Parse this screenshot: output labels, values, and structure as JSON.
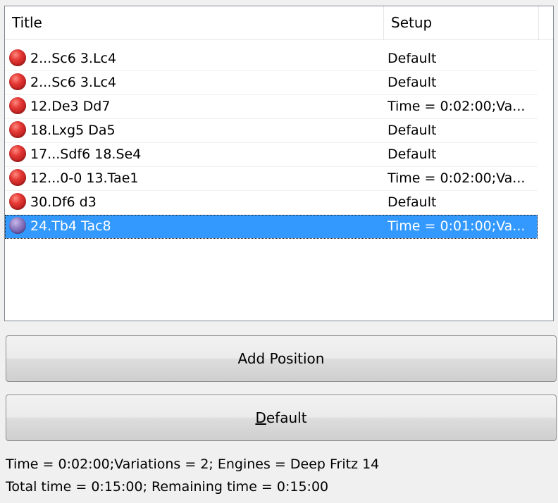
{
  "table": {
    "columns": [
      "Title",
      "Setup"
    ],
    "rows": [
      {
        "title": "2...Sc6 3.Lc4",
        "setup": "Default",
        "icon": "red-ball-icon"
      },
      {
        "title": "2...Sc6 3.Lc4",
        "setup": "Default",
        "icon": "red-ball-icon"
      },
      {
        "title": "12.De3 Dd7",
        "setup": "Time = 0:02:00;Va...",
        "icon": "red-ball-icon"
      },
      {
        "title": "18.Lxg5 Da5",
        "setup": "Default",
        "icon": "red-ball-icon"
      },
      {
        "title": "17...Sdf6 18.Se4",
        "setup": "Default",
        "icon": "red-ball-icon"
      },
      {
        "title": "12...0-0 13.Tae1",
        "setup": "Time = 0:02:00;Va...",
        "icon": "red-ball-icon"
      },
      {
        "title": "30.Df6 d3",
        "setup": "Default",
        "icon": "red-ball-icon"
      },
      {
        "title": "24.Tb4 Tac8",
        "setup": "Time = 0:01:00;Va...",
        "icon": "purple-ball-icon",
        "selected": true
      }
    ]
  },
  "buttons": {
    "add_position": "Add Position",
    "default_mnemonic": "D",
    "default_rest": "efault"
  },
  "status": {
    "line1": "Time = 0:02:00;Variations = 2; Engines = Deep Fritz 14",
    "line2": "Total time = 0:15:00; Remaining time = 0:15:00"
  },
  "colors": {
    "selection": "#3399ff",
    "red_ball": "#d32f2f",
    "purple_ball": "#7e6bb3"
  }
}
